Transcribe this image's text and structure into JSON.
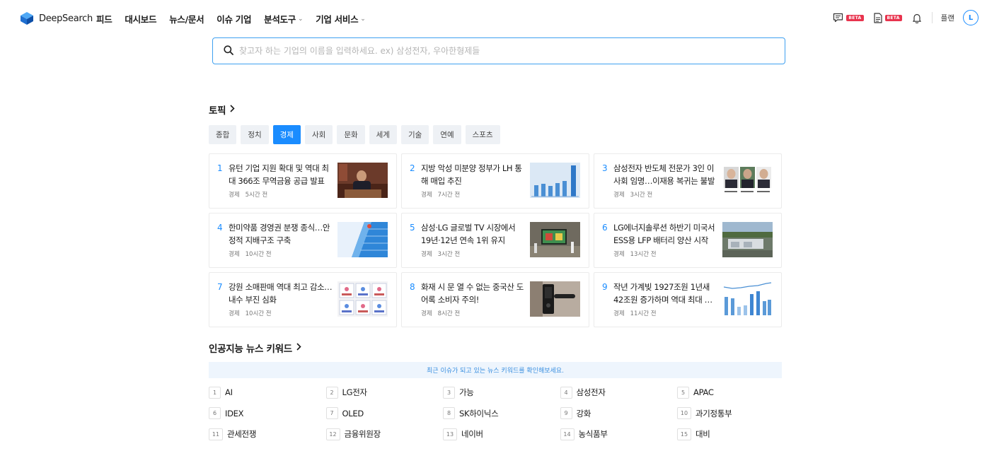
{
  "brand": {
    "name": "DeepSearch"
  },
  "nav": {
    "items": [
      {
        "label": "피드",
        "dropdown": false
      },
      {
        "label": "대시보드",
        "dropdown": false
      },
      {
        "label": "뉴스/문서",
        "dropdown": false
      },
      {
        "label": "이슈 기업",
        "dropdown": false
      },
      {
        "label": "분석도구",
        "dropdown": true
      },
      {
        "label": "기업 서비스",
        "dropdown": true
      }
    ]
  },
  "toolbar": {
    "beta_label": "BETA",
    "plan_label": "플랜",
    "avatar_initial": "L"
  },
  "search": {
    "placeholder": "찾고자 하는 기업의 이름을 입력하세요. ex) 삼성전자, 우아한형제들",
    "value": ""
  },
  "topics": {
    "title": "토픽",
    "tabs": [
      "종합",
      "정치",
      "경제",
      "사회",
      "문화",
      "세계",
      "기술",
      "연예",
      "스포츠"
    ],
    "active_tab": "경제",
    "news": [
      {
        "rank": "1",
        "title": "유턴 기업 지원 확대 및 역대 최대 366조 무역금융 공급 발표",
        "category": "경제",
        "time": "5시간 전"
      },
      {
        "rank": "2",
        "title": "지방 악성 미분양 정부가 LH 통해 매입 추진",
        "category": "경제",
        "time": "7시간 전"
      },
      {
        "rank": "3",
        "title": "삼성전자 반도체 전문가 3인 이사회 임명…이재용 복귀는 불발",
        "category": "경제",
        "time": "3시간 전"
      },
      {
        "rank": "4",
        "title": "한미약품 경영권 분쟁 종식…안정적 지배구조 구축",
        "category": "경제",
        "time": "10시간 전"
      },
      {
        "rank": "5",
        "title": "삼성·LG 글로벌 TV 시장에서 19년·12년 연속 1위 유지",
        "category": "경제",
        "time": "3시간 전"
      },
      {
        "rank": "6",
        "title": "LG에너지솔루션 하반기 미국서 ESS용 LFP 배터리 양산 시작",
        "category": "경제",
        "time": "13시간 전"
      },
      {
        "rank": "7",
        "title": "강원 소매판매 역대 최고 감소…내수 부진 심화",
        "category": "경제",
        "time": "10시간 전"
      },
      {
        "rank": "8",
        "title": "화재 시 문 열 수 없는 중국산 도어록 소비자 주의!",
        "category": "경제",
        "time": "8시간 전"
      },
      {
        "rank": "9",
        "title": "작년 가계빚 1927조원 1년새 42조원 증가하며 역대 최대 …",
        "category": "경제",
        "time": "11시간 전"
      }
    ]
  },
  "keywords": {
    "title": "인공지능 뉴스 키워드",
    "banner": "최근 이슈가 되고 있는 뉴스 키워드를 확인해보세요.",
    "items": [
      {
        "rank": "1",
        "label": "AI"
      },
      {
        "rank": "2",
        "label": "LG전자"
      },
      {
        "rank": "3",
        "label": "가능"
      },
      {
        "rank": "4",
        "label": "삼성전자"
      },
      {
        "rank": "5",
        "label": "APAC"
      },
      {
        "rank": "6",
        "label": "IDEX"
      },
      {
        "rank": "7",
        "label": "OLED"
      },
      {
        "rank": "8",
        "label": "SK하이닉스"
      },
      {
        "rank": "9",
        "label": "강화"
      },
      {
        "rank": "10",
        "label": "과기정통부"
      },
      {
        "rank": "11",
        "label": "관세전쟁"
      },
      {
        "rank": "12",
        "label": "금융위원장"
      },
      {
        "rank": "13",
        "label": "네이버"
      },
      {
        "rank": "14",
        "label": "농식품부"
      },
      {
        "rank": "15",
        "label": "대비"
      }
    ]
  },
  "colors": {
    "accent": "#1a8cff",
    "beta": "#e8344e",
    "banner_bg": "#eef5fd"
  }
}
